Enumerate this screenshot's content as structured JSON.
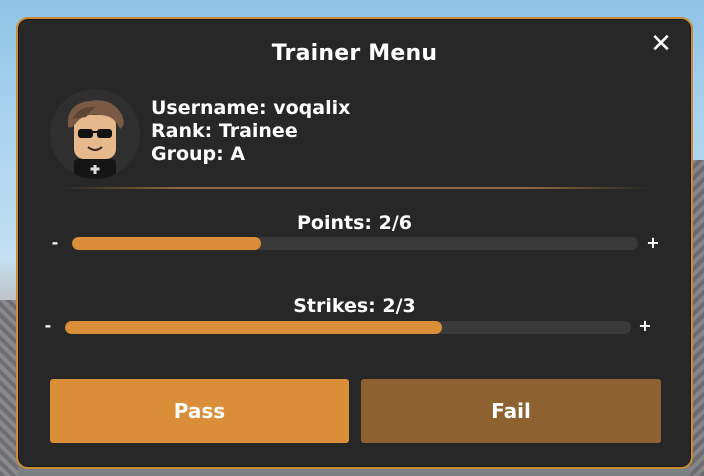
{
  "menu": {
    "title": "Trainer Menu",
    "close_glyph": "✕"
  },
  "user": {
    "username_line": "Username: voqalix",
    "rank_line": "Rank: Trainee",
    "group_line": "Group: A"
  },
  "points": {
    "label": "Points: 2/6",
    "current": 2,
    "max": 6,
    "decrement": "-",
    "increment": "+"
  },
  "strikes": {
    "label": "Strikes: 2/3",
    "current": 2,
    "max": 3,
    "decrement": "-",
    "increment": "+"
  },
  "actions": {
    "pass_label": "Pass",
    "fail_label": "Fail"
  },
  "colors": {
    "accent": "#d98e37",
    "fail_button": "#8d6230",
    "panel_bg": "#272727",
    "panel_border": "#c98c35",
    "track": "#3a3a3a"
  },
  "icons": {
    "close": "close-icon",
    "avatar": "avatar-image"
  }
}
